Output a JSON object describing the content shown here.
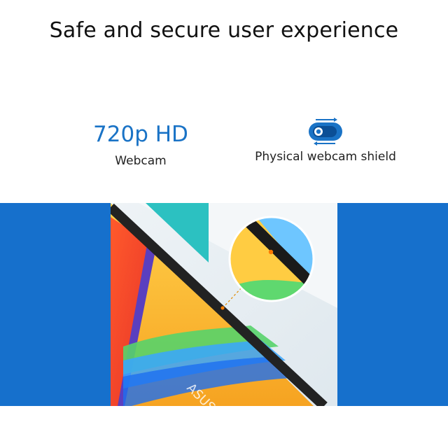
{
  "headline": "Safe and secure user experience",
  "features": {
    "webcam": {
      "value": "720p HD",
      "label": "Webcam"
    },
    "shield": {
      "label": "Physical webcam shield",
      "icon": "webcam-shield-toggle-icon"
    }
  },
  "hero": {
    "brand_text": "ASUS"
  },
  "colors": {
    "accent": "#1a73c6",
    "band": "#1670cc"
  }
}
